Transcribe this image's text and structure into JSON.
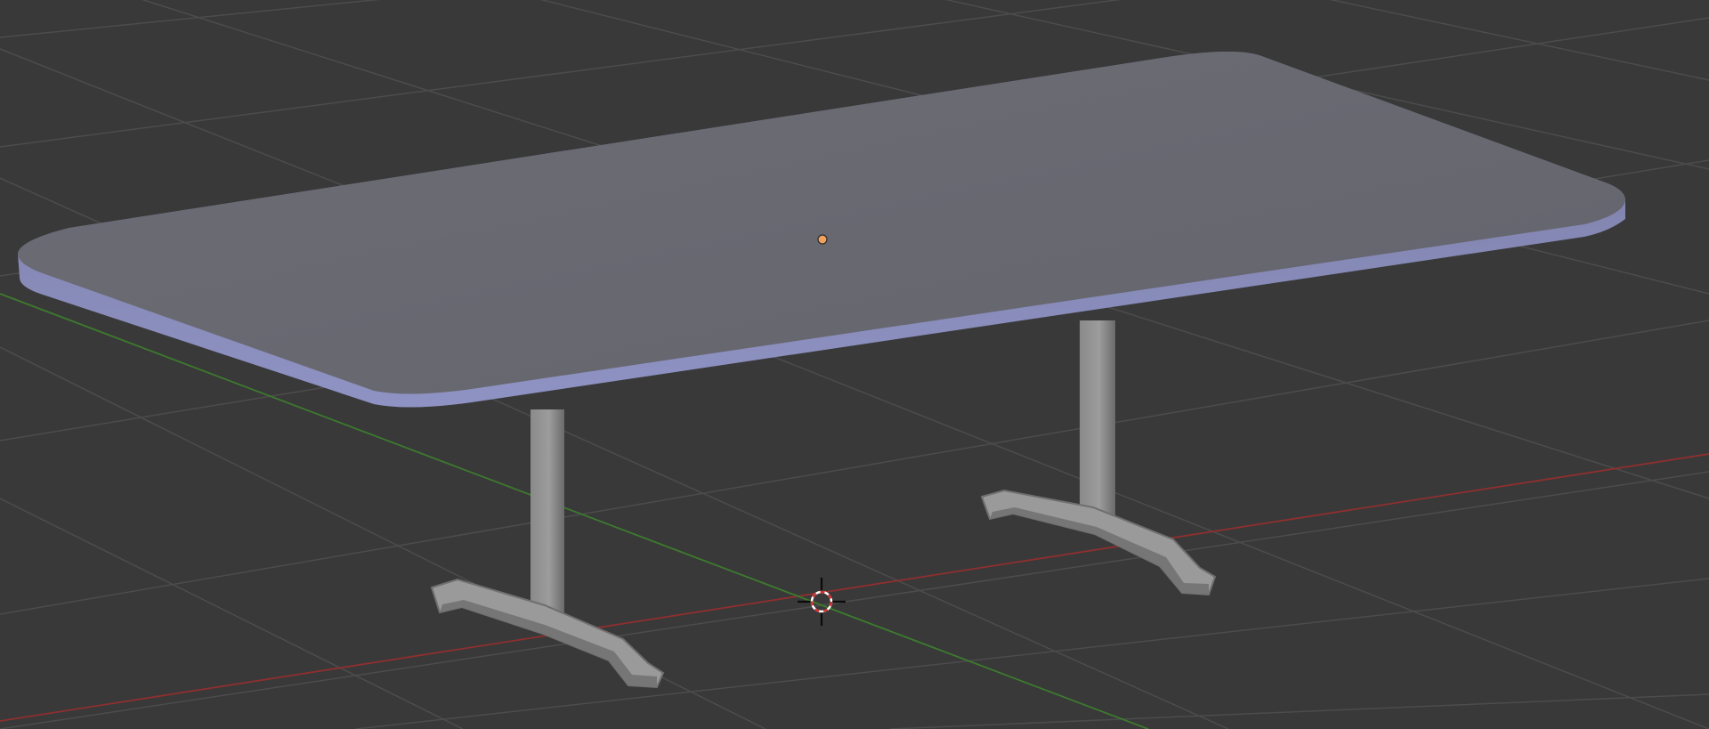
{
  "viewport": {
    "mode": "3d-viewport",
    "background_color": "#393939",
    "grid_line_color": "#4a4a4a",
    "x_axis_color": "#8e2f2f",
    "y_axis_color": "#3d7a2e"
  },
  "scene": {
    "object": "table",
    "object_color": "#707078",
    "object_outline_color": "#8e93c6",
    "origin_point_color": "#f1a15e",
    "origin_icon": "object-origin-icon",
    "cursor_icon": "3d-cursor-icon"
  }
}
